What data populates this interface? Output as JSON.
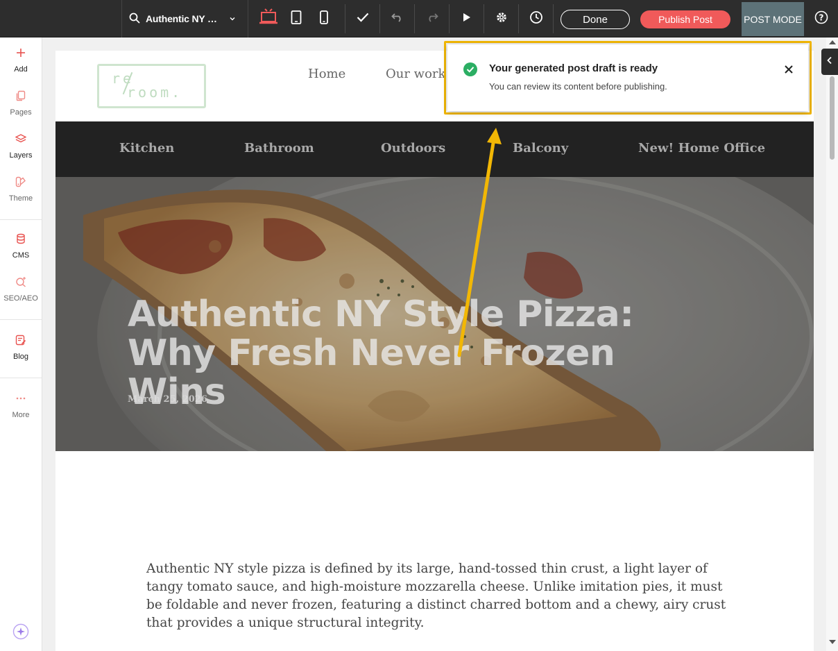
{
  "toolbar": {
    "page_name": "Authentic NY Style Pizza: Why Fresh Never Frozen Wins",
    "done_label": "Done",
    "publish_label": "Publish Post",
    "mode_label": "POST MODE",
    "icons": [
      "search-icon",
      "chevron-down-icon",
      "desktop-icon",
      "tablet-icon",
      "mobile-icon",
      "check-icon",
      "undo-icon",
      "redo-icon",
      "play-icon",
      "gear-icon",
      "history-icon",
      "help-icon"
    ],
    "accent": "#f05a5a",
    "active_device_color": "#f05a5a"
  },
  "sidebar": {
    "items": [
      {
        "label": "Add",
        "icon": "plus-icon"
      },
      {
        "label": "Pages",
        "icon": "pages-icon"
      },
      {
        "label": "Layers",
        "icon": "layers-icon"
      },
      {
        "label": "Theme",
        "icon": "theme-icon"
      },
      {
        "label": "CMS",
        "icon": "database-icon"
      },
      {
        "label": "SEO/AEO",
        "icon": "seo-icon"
      },
      {
        "label": "Blog",
        "icon": "blog-icon"
      },
      {
        "label": "More",
        "icon": "more-icon"
      }
    ]
  },
  "site": {
    "logo_top": "re",
    "logo_bottom": "room.",
    "nav": [
      "Home",
      "Our work"
    ],
    "categories": [
      "Kitchen",
      "Bathroom",
      "Outdoors",
      "Balcony",
      "New! Home Office"
    ]
  },
  "post": {
    "title": "Authentic NY Style Pizza: Why Fresh Never Frozen Wins",
    "date": "March 25, 2026",
    "body": "Authentic NY style pizza is defined by its large, hand-tossed thin crust, a light layer of tangy tomato sauce, and high-moisture mozzarella cheese. Unlike imitation pies, it must be foldable and never frozen, featuring a distinct charred bottom and a chewy, airy crust that provides a unique structural integrity."
  },
  "toast": {
    "title": "Your generated post draft is ready",
    "message": "You can review its content before publishing.",
    "status_color": "#2bae63",
    "highlight_color": "#f2b705"
  }
}
